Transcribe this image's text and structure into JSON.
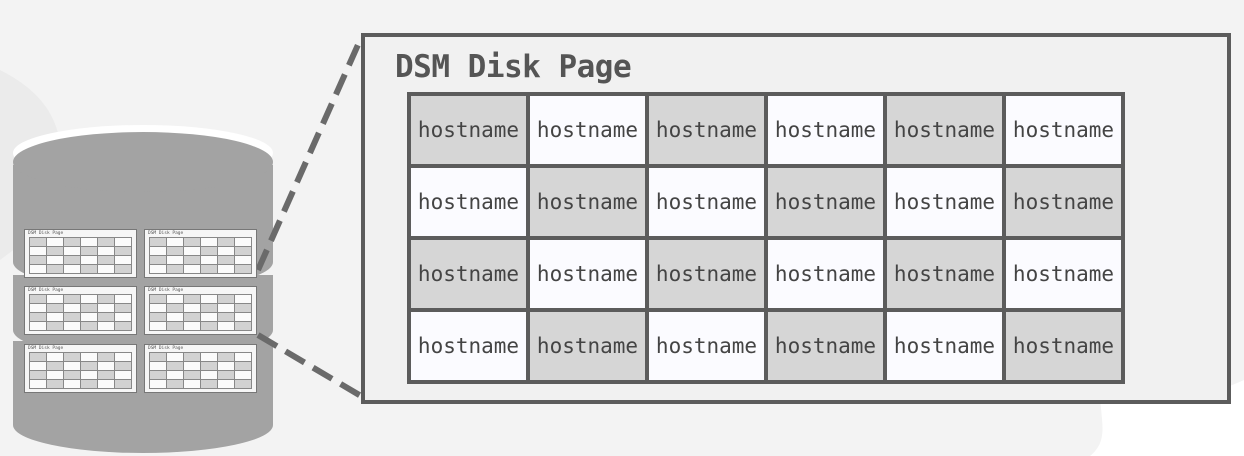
{
  "panel": {
    "title": "DSM Disk Page"
  },
  "grid": {
    "rows": [
      [
        "hostname",
        "hostname",
        "hostname",
        "hostname",
        "hostname",
        "hostname"
      ],
      [
        "hostname",
        "hostname",
        "hostname",
        "hostname",
        "hostname",
        "hostname"
      ],
      [
        "hostname",
        "hostname",
        "hostname",
        "hostname",
        "hostname",
        "hostname"
      ],
      [
        "hostname",
        "hostname",
        "hostname",
        "hostname",
        "hostname",
        "hostname"
      ]
    ],
    "shading": [
      [
        "gray",
        "white",
        "gray",
        "white",
        "gray",
        "white"
      ],
      [
        "white",
        "gray",
        "white",
        "gray",
        "white",
        "gray"
      ],
      [
        "gray",
        "white",
        "gray",
        "white",
        "gray",
        "white"
      ],
      [
        "white",
        "gray",
        "white",
        "gray",
        "white",
        "gray"
      ]
    ]
  },
  "database": {
    "pages_per_layer": 2,
    "layers": 3,
    "mini_page_title": "DSM Disk Page"
  },
  "colors": {
    "background": "#f3f3f3",
    "cylinder": "#a3a3a3",
    "cylinder_top": "#b4b4b4",
    "border": "#5c5c5c",
    "cell_gray": "#d6d6d6",
    "cell_white": "#fbfbff",
    "text": "#444444"
  }
}
